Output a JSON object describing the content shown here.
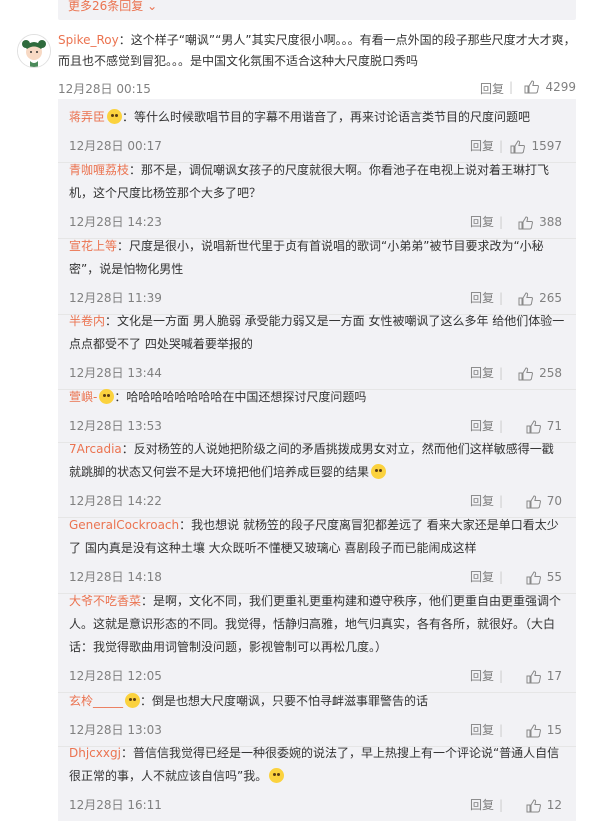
{
  "top_more": {
    "label": "更多26条回复 ⌄"
  },
  "main": {
    "user": "Spike_Roy",
    "text": "：这个样子“嘲讽”“男人”其实尺度很小啊。。。有看一点外国的段子那些尺度才大才爽，而且也不感觉到冒犯。。。是中国文化氛围不适合这种大尺度脱口秀吗",
    "time": "12月28日 00:15",
    "reply_label": "回复",
    "likes": "4299"
  },
  "replies": [
    {
      "user": "蒋弄臣",
      "badge": true,
      "text": "：等什么时候歌唱节目的字幕不用谐音了，再来讨论语言类节目的尺度问题吧",
      "time": "12月28日 00:17",
      "likes": "1597"
    },
    {
      "user": "青咖喱荔枝",
      "badge": false,
      "text": "：那不是，调侃嘲讽女孩子的尺度就很大啊。你看池子在电视上说对着王琳打飞机，这个尺度比杨笠那个大多了吧？",
      "time": "12月28日 14:23",
      "likes": "388"
    },
    {
      "user": "宣花上等",
      "badge": false,
      "text": "：尺度是很小，说唱新世代里于贞有首说唱的歌词“小弟弟”被节目要求改为“小秘密”，说是怕物化男性",
      "time": "12月28日 11:39",
      "likes": "265"
    },
    {
      "user": "半卷内",
      "badge": false,
      "text": "：文化是一方面 男人脆弱 承受能力弱又是一方面 女性被嘲讽了这么多年 给他们体验一点点都受不了 四处哭喊着要举报的",
      "time": "12月28日 13:44",
      "likes": "258"
    },
    {
      "user": "萱嶼-",
      "badge": true,
      "text": "：哈哈哈哈哈哈哈哈在中国还想探讨尺度问题吗",
      "time": "12月28日 13:53",
      "likes": "71"
    },
    {
      "user": "7Arcadia",
      "badge": false,
      "text": "：反对杨笠的人说她把阶级之间的矛盾挑拨成男女对立，然而他们这样敏感得一戳就跳脚的状态又何尝不是大环境把他们培养成巨婴的结果",
      "emoji": true,
      "time": "12月28日 14:22",
      "likes": "70"
    },
    {
      "user": "GeneralCockroach",
      "badge": false,
      "text": "：我也想说 就杨笠的段子尺度离冒犯都差远了 看来大家还是单口看太少了 国内真是没有这种土壤 大众既听不懂梗又玻璃心 喜剧段子而已能闹成这样",
      "time": "12月28日 14:18",
      "likes": "55"
    },
    {
      "user": "大爷不吃香菜",
      "badge": false,
      "text": "：是啊，文化不同，我们更重礼更重构建和遵守秩序，他们更重自由更重强调个人。这就是意识形态的不同。我觉得，恬静归高雅，地气归真实，各有各所，就很好。（大白话：我觉得歌曲用词管制没问题，影视管制可以再松几度。）",
      "time": "12月28日 12:05",
      "likes": "17"
    },
    {
      "user": "玄柃_____",
      "badge": true,
      "text": "：倒是也想大尺度嘲讽，只要不怕寻衅滋事罪警告的话",
      "time": "12月28日 13:03",
      "likes": "15"
    },
    {
      "user": "Dhjcxxgj",
      "badge": false,
      "text": "：普信信我觉得已经是一种很委婉的说法了，早上热搜上有一个评论说“普通人自信很正常的事，人不就应该自信吗”我。",
      "emoji": true,
      "time": "12月28日 16:11",
      "likes": "12"
    }
  ]
}
